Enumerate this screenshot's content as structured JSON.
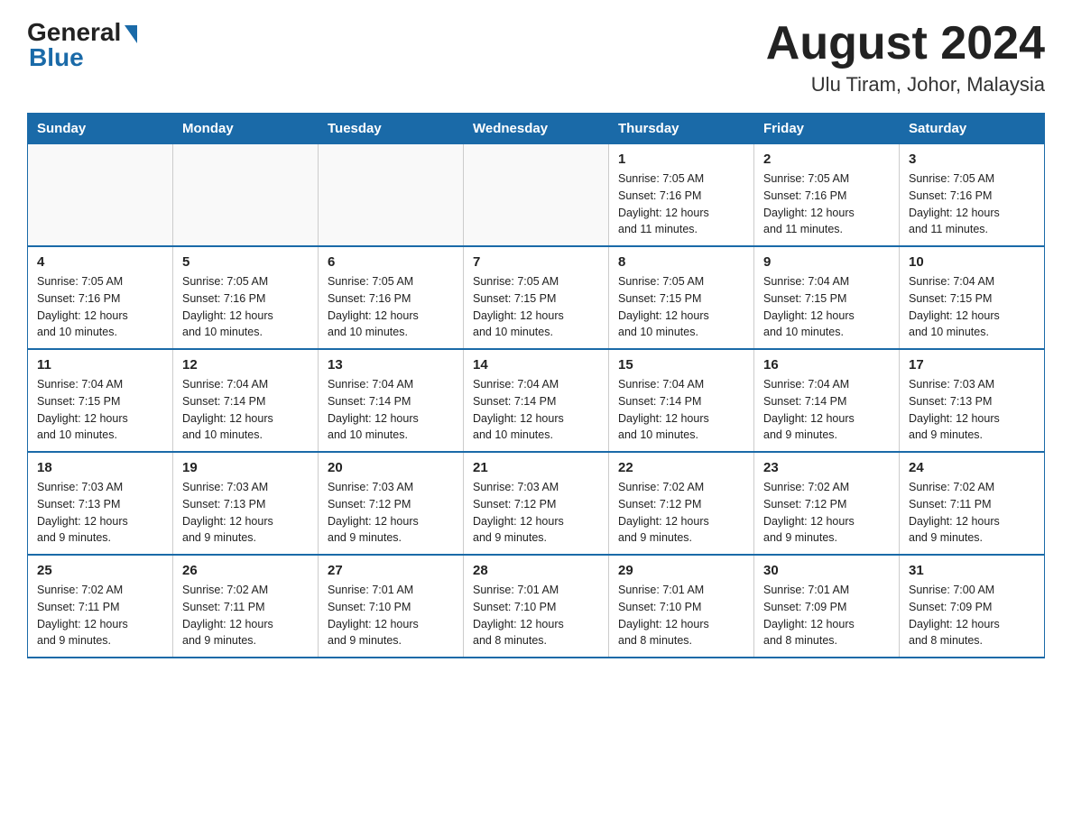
{
  "header": {
    "logo_general": "General",
    "logo_blue": "Blue",
    "month_year": "August 2024",
    "location": "Ulu Tiram, Johor, Malaysia"
  },
  "days_of_week": [
    "Sunday",
    "Monday",
    "Tuesday",
    "Wednesday",
    "Thursday",
    "Friday",
    "Saturday"
  ],
  "weeks": [
    [
      {
        "day": "",
        "info": ""
      },
      {
        "day": "",
        "info": ""
      },
      {
        "day": "",
        "info": ""
      },
      {
        "day": "",
        "info": ""
      },
      {
        "day": "1",
        "info": "Sunrise: 7:05 AM\nSunset: 7:16 PM\nDaylight: 12 hours\nand 11 minutes."
      },
      {
        "day": "2",
        "info": "Sunrise: 7:05 AM\nSunset: 7:16 PM\nDaylight: 12 hours\nand 11 minutes."
      },
      {
        "day": "3",
        "info": "Sunrise: 7:05 AM\nSunset: 7:16 PM\nDaylight: 12 hours\nand 11 minutes."
      }
    ],
    [
      {
        "day": "4",
        "info": "Sunrise: 7:05 AM\nSunset: 7:16 PM\nDaylight: 12 hours\nand 10 minutes."
      },
      {
        "day": "5",
        "info": "Sunrise: 7:05 AM\nSunset: 7:16 PM\nDaylight: 12 hours\nand 10 minutes."
      },
      {
        "day": "6",
        "info": "Sunrise: 7:05 AM\nSunset: 7:16 PM\nDaylight: 12 hours\nand 10 minutes."
      },
      {
        "day": "7",
        "info": "Sunrise: 7:05 AM\nSunset: 7:15 PM\nDaylight: 12 hours\nand 10 minutes."
      },
      {
        "day": "8",
        "info": "Sunrise: 7:05 AM\nSunset: 7:15 PM\nDaylight: 12 hours\nand 10 minutes."
      },
      {
        "day": "9",
        "info": "Sunrise: 7:04 AM\nSunset: 7:15 PM\nDaylight: 12 hours\nand 10 minutes."
      },
      {
        "day": "10",
        "info": "Sunrise: 7:04 AM\nSunset: 7:15 PM\nDaylight: 12 hours\nand 10 minutes."
      }
    ],
    [
      {
        "day": "11",
        "info": "Sunrise: 7:04 AM\nSunset: 7:15 PM\nDaylight: 12 hours\nand 10 minutes."
      },
      {
        "day": "12",
        "info": "Sunrise: 7:04 AM\nSunset: 7:14 PM\nDaylight: 12 hours\nand 10 minutes."
      },
      {
        "day": "13",
        "info": "Sunrise: 7:04 AM\nSunset: 7:14 PM\nDaylight: 12 hours\nand 10 minutes."
      },
      {
        "day": "14",
        "info": "Sunrise: 7:04 AM\nSunset: 7:14 PM\nDaylight: 12 hours\nand 10 minutes."
      },
      {
        "day": "15",
        "info": "Sunrise: 7:04 AM\nSunset: 7:14 PM\nDaylight: 12 hours\nand 10 minutes."
      },
      {
        "day": "16",
        "info": "Sunrise: 7:04 AM\nSunset: 7:14 PM\nDaylight: 12 hours\nand 9 minutes."
      },
      {
        "day": "17",
        "info": "Sunrise: 7:03 AM\nSunset: 7:13 PM\nDaylight: 12 hours\nand 9 minutes."
      }
    ],
    [
      {
        "day": "18",
        "info": "Sunrise: 7:03 AM\nSunset: 7:13 PM\nDaylight: 12 hours\nand 9 minutes."
      },
      {
        "day": "19",
        "info": "Sunrise: 7:03 AM\nSunset: 7:13 PM\nDaylight: 12 hours\nand 9 minutes."
      },
      {
        "day": "20",
        "info": "Sunrise: 7:03 AM\nSunset: 7:12 PM\nDaylight: 12 hours\nand 9 minutes."
      },
      {
        "day": "21",
        "info": "Sunrise: 7:03 AM\nSunset: 7:12 PM\nDaylight: 12 hours\nand 9 minutes."
      },
      {
        "day": "22",
        "info": "Sunrise: 7:02 AM\nSunset: 7:12 PM\nDaylight: 12 hours\nand 9 minutes."
      },
      {
        "day": "23",
        "info": "Sunrise: 7:02 AM\nSunset: 7:12 PM\nDaylight: 12 hours\nand 9 minutes."
      },
      {
        "day": "24",
        "info": "Sunrise: 7:02 AM\nSunset: 7:11 PM\nDaylight: 12 hours\nand 9 minutes."
      }
    ],
    [
      {
        "day": "25",
        "info": "Sunrise: 7:02 AM\nSunset: 7:11 PM\nDaylight: 12 hours\nand 9 minutes."
      },
      {
        "day": "26",
        "info": "Sunrise: 7:02 AM\nSunset: 7:11 PM\nDaylight: 12 hours\nand 9 minutes."
      },
      {
        "day": "27",
        "info": "Sunrise: 7:01 AM\nSunset: 7:10 PM\nDaylight: 12 hours\nand 9 minutes."
      },
      {
        "day": "28",
        "info": "Sunrise: 7:01 AM\nSunset: 7:10 PM\nDaylight: 12 hours\nand 8 minutes."
      },
      {
        "day": "29",
        "info": "Sunrise: 7:01 AM\nSunset: 7:10 PM\nDaylight: 12 hours\nand 8 minutes."
      },
      {
        "day": "30",
        "info": "Sunrise: 7:01 AM\nSunset: 7:09 PM\nDaylight: 12 hours\nand 8 minutes."
      },
      {
        "day": "31",
        "info": "Sunrise: 7:00 AM\nSunset: 7:09 PM\nDaylight: 12 hours\nand 8 minutes."
      }
    ]
  ]
}
